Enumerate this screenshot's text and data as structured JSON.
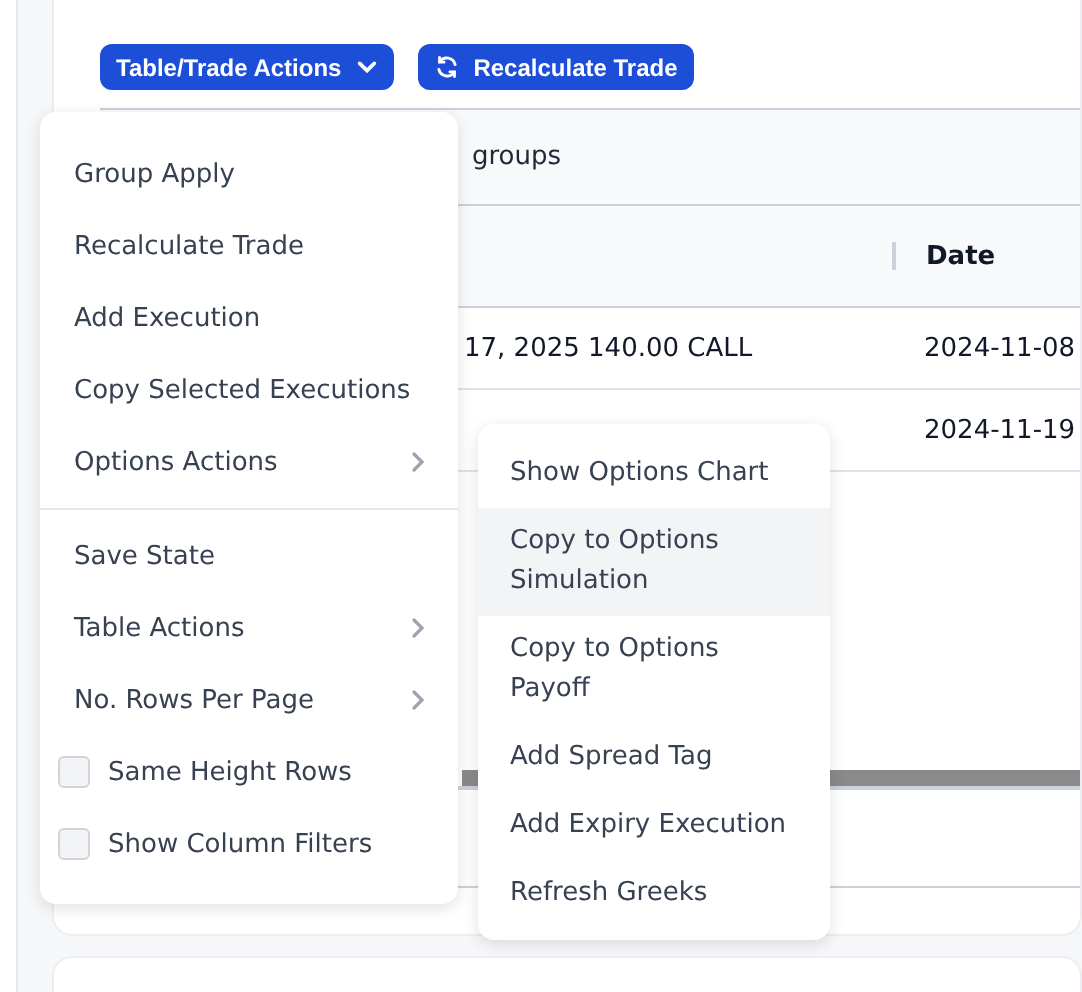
{
  "toolbar": {
    "buttons": [
      {
        "label": "Table/Trade Actions",
        "kind": "dropdown"
      },
      {
        "label": "Recalculate Trade",
        "kind": "refresh"
      }
    ]
  },
  "table": {
    "group_hint": "groups",
    "columns": [
      "Date"
    ],
    "rows": [
      {
        "column_1": "17, 2025 140.00 CALL",
        "date": "2024-11-08"
      },
      {
        "date": "2024-11-19"
      }
    ]
  },
  "menu": {
    "sections": [
      {
        "items": [
          {
            "label": "Group Apply",
            "kind": "action"
          },
          {
            "label": "Recalculate Trade",
            "kind": "action"
          },
          {
            "label": "Add Execution",
            "kind": "action"
          },
          {
            "label": "Copy Selected Executions",
            "kind": "action"
          },
          {
            "label": "Options Actions",
            "kind": "submenu"
          }
        ]
      },
      {
        "items": [
          {
            "label": "Save State",
            "kind": "action"
          },
          {
            "label": "Table Actions",
            "kind": "submenu"
          },
          {
            "label": "No. Rows Per Page",
            "kind": "submenu"
          },
          {
            "label": "Same Height Rows",
            "kind": "checkbox",
            "checked": false
          },
          {
            "label": "Show Column Filters",
            "kind": "checkbox",
            "checked": false
          }
        ]
      }
    ]
  },
  "submenu": {
    "items": [
      {
        "label": "Show Options Chart",
        "selected": false
      },
      {
        "label": "Copy to Options Simulation",
        "selected": true
      },
      {
        "label": "Copy to Options Payoff",
        "selected": false
      },
      {
        "label": "Add Spread Tag",
        "selected": false
      },
      {
        "label": "Add Expiry Execution",
        "selected": false
      },
      {
        "label": "Refresh Greeks",
        "selected": false
      }
    ]
  }
}
